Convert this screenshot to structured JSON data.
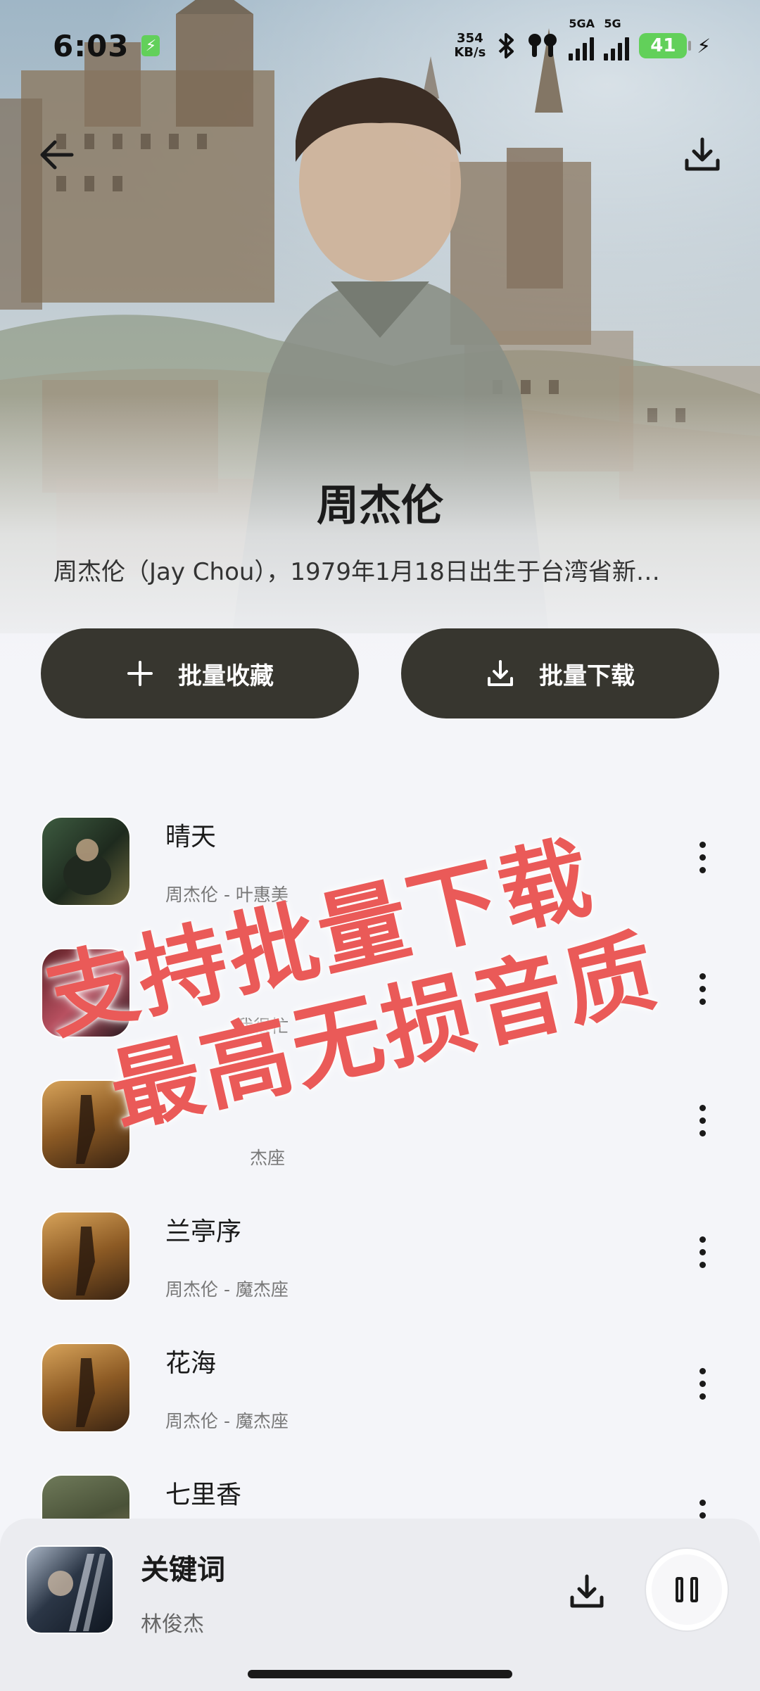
{
  "status_bar": {
    "time": "6:03",
    "net_speed_value": "354",
    "net_speed_unit": "KB/s",
    "sim1_label": "5GA",
    "sim2_label": "5G",
    "battery": "41"
  },
  "artist": {
    "name": "周杰伦",
    "description": "周杰伦（Jay Chou），1979年1月18日出生于台湾省新…"
  },
  "actions": {
    "batch_favorite": "批量收藏",
    "batch_download": "批量下载"
  },
  "songs": [
    {
      "title": "晴天",
      "subtitle": "周杰伦 - 叶惠美"
    },
    {
      "title": "",
      "subtitle": "我很忙"
    },
    {
      "title": "",
      "subtitle": "杰座"
    },
    {
      "title": "兰亭序",
      "subtitle": "周杰伦 - 魔杰座"
    },
    {
      "title": "花海",
      "subtitle": "周杰伦 - 魔杰座"
    },
    {
      "title": "七里香",
      "subtitle": ""
    }
  ],
  "promo": {
    "line1": "支持批量下载",
    "line2": "最高无损音质",
    "color": "#ea5a58"
  },
  "now_playing": {
    "title": "关键词",
    "artist": "林俊杰"
  },
  "colors": {
    "button_bg": "#37362f",
    "page_bg": "#f4f5f9",
    "battery": "#62d05a"
  }
}
